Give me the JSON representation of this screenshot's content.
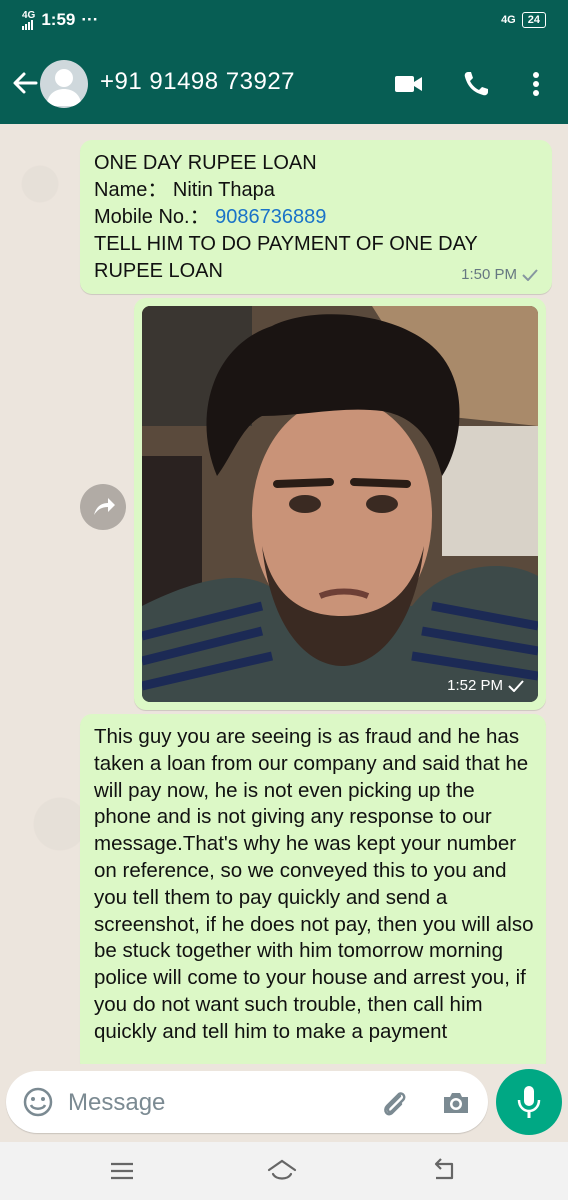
{
  "status_bar": {
    "network": "4G",
    "time": "1:59",
    "more": "···",
    "network_right": "4G",
    "battery": "24"
  },
  "header": {
    "contact_name": "+91 91498 73927"
  },
  "messages": [
    {
      "line1": "ONE DAY RUPEE LOAN",
      "name_label": "Name：",
      "name_value": "Nitin Thapa",
      "mobile_label": "Mobile No.：",
      "mobile_value": "9086736889",
      "line4": "TELL HIM TO DO PAYMENT OF ONE DAY RUPEE LOAN",
      "time": "1:50 PM"
    },
    {
      "type": "image",
      "time": "1:52 PM"
    },
    {
      "text": "This guy you are seeing is as  fraud  and he has taken a loan from our company and said that he will pay now, he is not even picking up the phone and is not giving any response to our message.That's why he was kept your number  on reference, so we conveyed this to you and you tell them to pay quickly and send a screenshot, if he does not pay, then you will also be stuck together with him tomorrow morning police will come to your house and arrest  you, if you do not want such trouble, then call him quickly and tell him to make a payment"
    }
  ],
  "composer": {
    "placeholder": "Message"
  },
  "colors": {
    "header": "#075e54",
    "bubble_out": "#dcf8c6",
    "chat_bg": "#ece5dd",
    "mic": "#00a884"
  }
}
